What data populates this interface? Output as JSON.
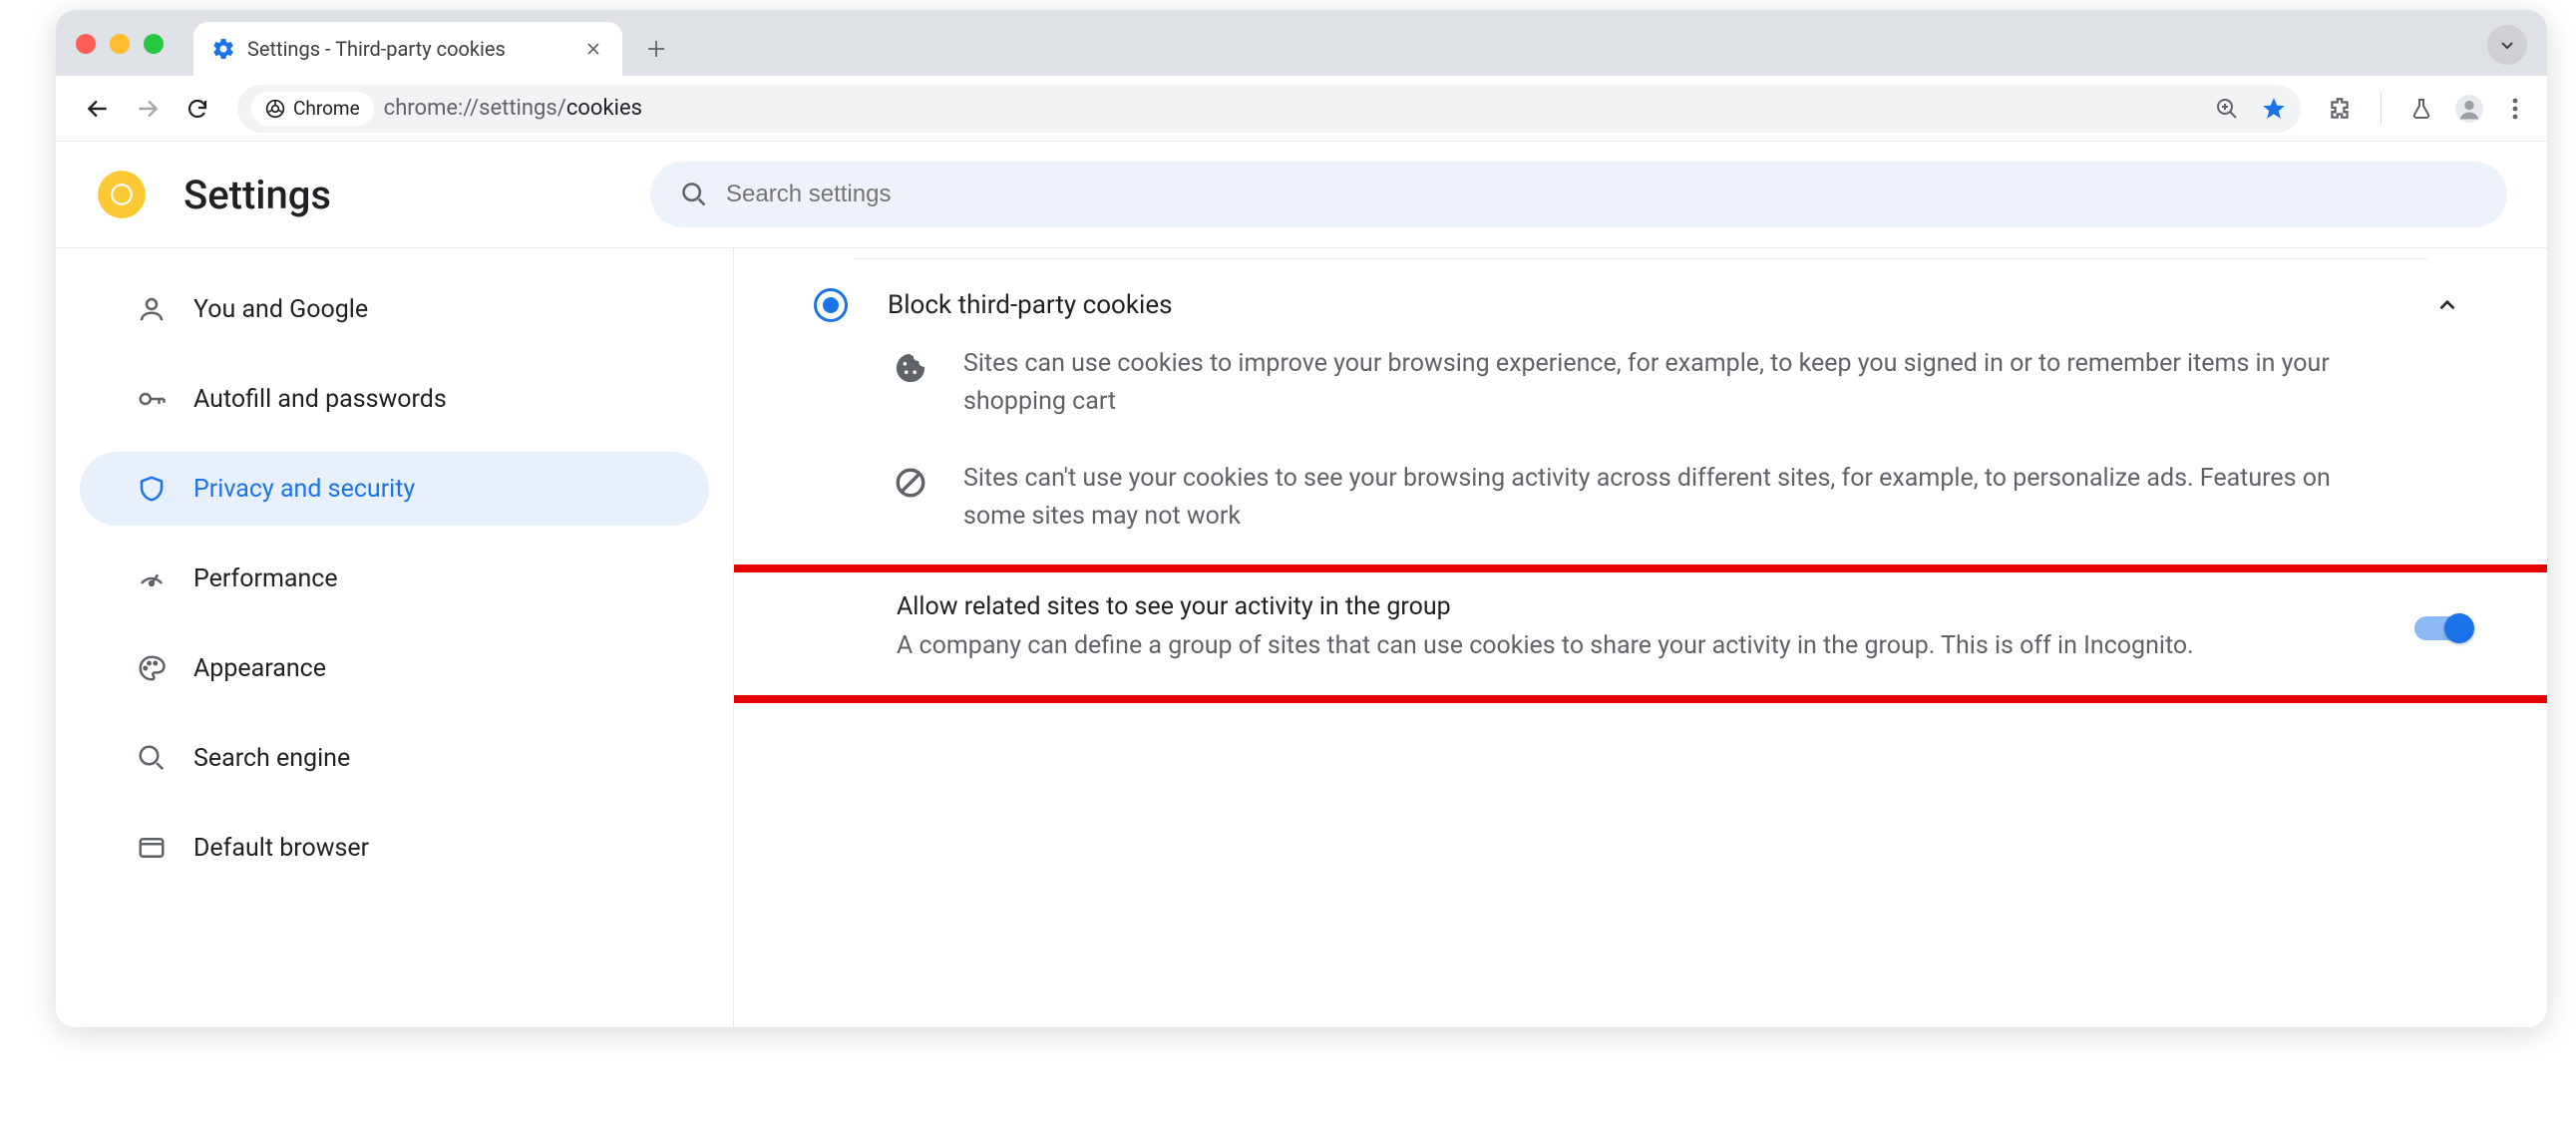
{
  "browser": {
    "tab_title": "Settings - Third-party cookies",
    "url_host": "chrome://settings/",
    "url_path": "cookies",
    "chip_label": "Chrome"
  },
  "header": {
    "title": "Settings",
    "search_placeholder": "Search settings"
  },
  "sidebar": {
    "items": [
      {
        "label": "You and Google"
      },
      {
        "label": "Autofill and passwords"
      },
      {
        "label": "Privacy and security"
      },
      {
        "label": "Performance"
      },
      {
        "label": "Appearance"
      },
      {
        "label": "Search engine"
      },
      {
        "label": "Default browser"
      }
    ],
    "active_index": 2
  },
  "content": {
    "radio_label": "Block third-party cookies",
    "desc1": "Sites can use cookies to improve your browsing experience, for example, to keep you signed in or to remember items in your shopping cart",
    "desc2": "Sites can't use your cookies to see your browsing activity across different sites, for example, to personalize ads. Features on some sites may not work",
    "toggle_title": "Allow related sites to see your activity in the group",
    "toggle_desc": "A company can define a group of sites that can use cookies to share your activity in the group. This is off in Incognito."
  }
}
